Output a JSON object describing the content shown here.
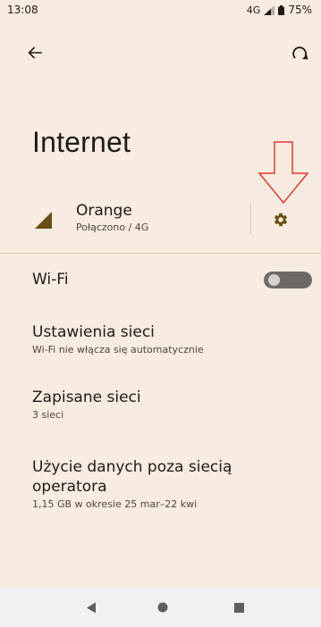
{
  "status_bar": {
    "time": "13:08",
    "network_type": "4G",
    "battery": "75%"
  },
  "top_bar": {
    "back_icon": "arrow-back-icon",
    "reset_icon": "network-reset-icon"
  },
  "page": {
    "title": "Internet"
  },
  "network": {
    "carrier": "Orange",
    "status": "Połączono / 4G",
    "settings_icon": "gear-icon"
  },
  "wifi": {
    "label": "Wi-Fi",
    "enabled": false
  },
  "items": [
    {
      "title": "Ustawienia sieci",
      "subtitle": "Wi-Fi nie włącza się automatycznie"
    },
    {
      "title": "Zapisane sieci",
      "subtitle": "3 sieci"
    },
    {
      "title": "Użycie danych poza siecią operatora",
      "subtitle": "1,15 GB w okresie 25 mar–22 kwi"
    }
  ],
  "colors": {
    "background": "#f8ebdf",
    "annotation_arrow": "#e53935",
    "accent_icon": "#6b4e16"
  },
  "nav": {
    "back_icon": "triangle-back-icon",
    "home_icon": "circle-home-icon",
    "recents_icon": "square-recents-icon"
  }
}
